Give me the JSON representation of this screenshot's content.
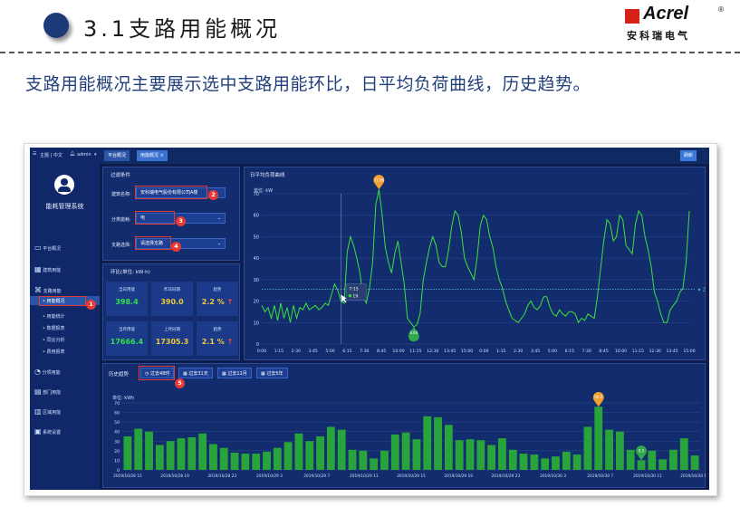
{
  "slide": {
    "section_title": "3.1支路用能概况",
    "subtitle": "支路用能概况主要展示选中支路用能环比，日平均负荷曲线，历史趋势。",
    "logo": {
      "brand": "Acrel",
      "chinese": "安科瑞电气",
      "registered": "®"
    }
  },
  "app": {
    "topbar": {
      "menu_text": "主题 | 中文",
      "user": "admin",
      "tabs": [
        "平台概况",
        "用能概况"
      ],
      "refresh_label": "刷新"
    },
    "sidebar": {
      "system_name": "能耗管理系统",
      "items": [
        {
          "label": "平台概况",
          "icon": "monitor-icon"
        },
        {
          "label": "建筑用能",
          "icon": "building-icon"
        },
        {
          "label": "支路用能",
          "icon": "branch-icon"
        },
        {
          "label": "分项用能",
          "icon": "gauge-icon"
        },
        {
          "label": "部门用能",
          "icon": "department-icon"
        },
        {
          "label": "区域用能",
          "icon": "region-icon"
        },
        {
          "label": "系统设置",
          "icon": "settings-icon"
        }
      ],
      "subitems": [
        "用能概况",
        "用能统计",
        "数据报表",
        "同比分析",
        "费用报表"
      ]
    },
    "filter": {
      "title": "过滤条件",
      "fields": [
        {
          "label": "建筑名称:",
          "value": "安科瑞电气股份有限公司A楼"
        },
        {
          "label": "分类能耗:",
          "value": "电"
        },
        {
          "label": "支路选择:",
          "value": "请选择支路"
        }
      ]
    },
    "ring": {
      "title": "环比(单位: kW·h)",
      "cards": [
        {
          "label": "当日用能",
          "value": "398.4"
        },
        {
          "label": "昨日同期",
          "value": "390.0"
        },
        {
          "label": "趋势",
          "value": "2.2 %"
        },
        {
          "label": "当月用能",
          "value": "17666.4"
        },
        {
          "label": "上月同期",
          "value": "17305.3"
        },
        {
          "label": "趋势",
          "value": "2.1 %"
        }
      ]
    },
    "daily": {
      "title": "日平均负荷曲线",
      "unit": "单位: kW",
      "avg_label": "25.46",
      "max_label": "71.66",
      "min_label": "8.84",
      "tooltip_time": "7:15",
      "tooltip_value": "19"
    },
    "history": {
      "title": "历史趋势",
      "buttons": [
        "过去48时",
        "过去31天",
        "过去12月",
        "过去5年"
      ],
      "unit": "单位: kWh",
      "max_label": "66.2",
      "min_label": "9.5"
    },
    "badges": [
      "1",
      "2",
      "3",
      "4",
      "5"
    ]
  },
  "chart_data": [
    {
      "type": "line",
      "title": "日平均负荷曲线",
      "ylabel": "单位: kW",
      "ylim": [
        0,
        70
      ],
      "x_ticks": [
        "0:00",
        "1:15",
        "2:30",
        "3:45",
        "5:00",
        "6:15",
        "7:30",
        "8:45",
        "10:00",
        "11:15",
        "12:30",
        "13:45",
        "15:00",
        "0:00",
        "1:15",
        "2:30",
        "3:45",
        "5:00",
        "6:15",
        "7:30",
        "8:45",
        "10:00",
        "11:15",
        "12:30",
        "13:45",
        "15:00"
      ],
      "series": [
        {
          "values": [
            18,
            15,
            17,
            12,
            18,
            11,
            19,
            12,
            17,
            10,
            18,
            12,
            17,
            16,
            19,
            16,
            17,
            18,
            16,
            17,
            19,
            18,
            23,
            28,
            25,
            20,
            19,
            43,
            50,
            46,
            40,
            33,
            22,
            19,
            26,
            38,
            65,
            72,
            60,
            45,
            38,
            33,
            42,
            48,
            38,
            28,
            12,
            10,
            8,
            9,
            14,
            30,
            38,
            45,
            50,
            46,
            38,
            36,
            36,
            44,
            55,
            62,
            60,
            52,
            40,
            36,
            33,
            30,
            40,
            55,
            60,
            58,
            50,
            45,
            36,
            30,
            26,
            20,
            16,
            12,
            11,
            10,
            12,
            14,
            18,
            20,
            17,
            16,
            18,
            22,
            22,
            17,
            14,
            13,
            16,
            14,
            13,
            15,
            15,
            14,
            10,
            12,
            11,
            14,
            13,
            12,
            22,
            35,
            48,
            58,
            56,
            48,
            50,
            60,
            58,
            46,
            44,
            42,
            56,
            62,
            60,
            50,
            44,
            36,
            24,
            20,
            14,
            10,
            10,
            16,
            18,
            20,
            24,
            26,
            38,
            62
          ]
        },
        {
          "name": "average",
          "values": [
            25.46
          ]
        }
      ]
    },
    {
      "type": "bar",
      "title": "历史趋势",
      "ylabel": "单位: kWh",
      "ylim": [
        0,
        70
      ],
      "x_ticks": [
        "2019/10/28 15",
        "2019/10/28 19",
        "2019/10/28 23",
        "2019/10/29 3",
        "2019/10/29 7",
        "2019/10/29 11",
        "2019/10/29 15",
        "2019/10/29 19",
        "2019/10/29 23",
        "2019/10/30 3",
        "2019/10/30 7",
        "2019/10/30 11",
        "2019/10/30 15"
      ],
      "values": [
        35,
        43,
        40,
        26,
        30,
        33,
        34,
        38,
        27,
        23,
        18,
        17,
        17,
        19,
        23,
        29,
        38,
        30,
        35,
        45,
        42,
        21,
        20,
        12,
        20,
        37,
        39,
        32,
        56,
        55,
        47,
        31,
        32,
        31,
        26,
        33,
        21,
        17,
        16,
        12,
        14,
        19,
        16,
        45,
        66,
        42,
        40,
        21,
        10,
        20,
        11,
        21,
        33,
        15
      ]
    }
  ]
}
